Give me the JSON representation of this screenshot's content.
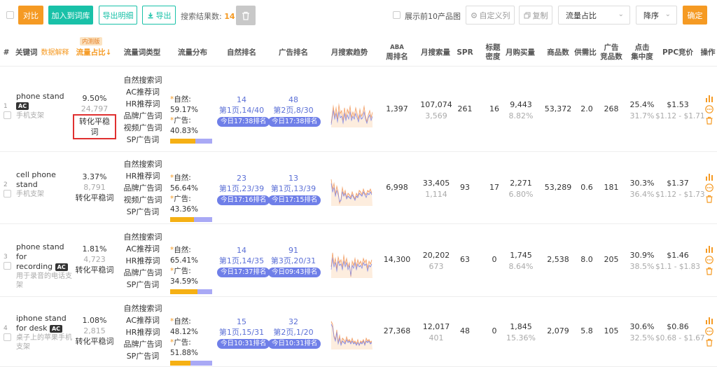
{
  "toolbar": {
    "compare_label": "对比",
    "add_library_label": "加入到词库",
    "export_detail_label": "导出明细",
    "export_label": "导出",
    "result_label": "搜索结果数:",
    "result_count": "14",
    "show_top10_label": "展示前10产品图",
    "custom_columns_label": "自定义列",
    "copy_label": "复制",
    "sort_field_value": "流量占比",
    "sort_order_value": "降序",
    "confirm_label": "确定"
  },
  "columns": {
    "index": "#",
    "keyword": "关键词",
    "keyword_sub": "数据解释",
    "beta": "内测版",
    "traffic_share": "流量占比",
    "traffic_type": "流量词类型",
    "traffic_dist": "流量分布",
    "organic_rank": "自然排名",
    "ad_rank": "广告排名",
    "trend": "月搜索趋势",
    "aba_rank_1": "ABA",
    "aba_rank_2": "周排名",
    "monthly_search": "月搜索量",
    "spr": "SPR",
    "title_density_1": "标题",
    "title_density_2": "密度",
    "monthly_purchase": "月购买量",
    "products": "商品数",
    "supply_ratio": "供需比",
    "ad_products_1": "广告",
    "ad_products_2": "竞品数",
    "click_conc_1": "点击",
    "click_conc_2": "集中度",
    "ppc": "PPC竞价",
    "actions": "操作"
  },
  "rows": [
    {
      "num": "1",
      "keyword_line1": "phone stand",
      "keyword_line2": "",
      "ac": "AC",
      "cn": "手机支架",
      "share": "9.50%",
      "share_sub": "24,797",
      "tag": "转化平稳词",
      "types": [
        "自然搜索词",
        "AC推荐词",
        "HR推荐词",
        "品牌广告词",
        "视频广告词",
        "SP广告词"
      ],
      "organic_label": "自然:",
      "organic_pct": "59.17%",
      "organic_frac": 0.5917,
      "ad_label": "广告:",
      "ad_pct": "40.83%",
      "org_rank": "14",
      "org_page": "第1页,14/40",
      "org_time": "今日17:38排名",
      "ad_rank": "48",
      "ad_page": "第2页,8/30",
      "ad_time": "今日17:38排名",
      "aba": "1,397",
      "search": "107,074",
      "search_sub": "3,569",
      "spr": "261",
      "density": "16",
      "purchase": "9,443",
      "purchase_pct": "8.82%",
      "products": "53,372",
      "supply": "2.0",
      "ad_products": "268",
      "click": "25.4%",
      "click_sub": "31.7%",
      "ppc": "$1.53",
      "ppc_range": "$1.12 - $1.71"
    },
    {
      "num": "2",
      "keyword_line1": "cell phone",
      "keyword_line2": "stand",
      "ac": "",
      "cn": "手机支架",
      "share": "3.37%",
      "share_sub": "8,791",
      "tag": "转化平稳词",
      "types": [
        "自然搜索词",
        "HR推荐词",
        "品牌广告词",
        "视频广告词",
        "SP广告词"
      ],
      "organic_label": "自然:",
      "organic_pct": "56.64%",
      "organic_frac": 0.5664,
      "ad_label": "广告:",
      "ad_pct": "43.36%",
      "org_rank": "23",
      "org_page": "第1页,23/39",
      "org_time": "今日17:16排名",
      "ad_rank": "13",
      "ad_page": "第1页,13/39",
      "ad_time": "今日17:15排名",
      "aba": "6,998",
      "search": "33,405",
      "search_sub": "1,114",
      "spr": "93",
      "density": "17",
      "purchase": "2,271",
      "purchase_pct": "6.80%",
      "products": "53,289",
      "supply": "0.6",
      "ad_products": "181",
      "click": "30.3%",
      "click_sub": "36.4%",
      "ppc": "$1.37",
      "ppc_range": "$1.12 - $1.73"
    },
    {
      "num": "3",
      "keyword_line1": "phone stand for",
      "keyword_line2": "recording",
      "ac": "AC",
      "cn": "用于录音的电话支架",
      "share": "1.81%",
      "share_sub": "4,723",
      "tag": "转化平稳词",
      "types": [
        "自然搜索词",
        "AC推荐词",
        "HR推荐词",
        "品牌广告词",
        "SP广告词"
      ],
      "organic_label": "自然:",
      "organic_pct": "65.41%",
      "organic_frac": 0.6541,
      "ad_label": "广告:",
      "ad_pct": "34.59%",
      "org_rank": "14",
      "org_page": "第1页,14/35",
      "org_time": "今日17:37排名",
      "ad_rank": "91",
      "ad_page": "第3页,20/31",
      "ad_time": "今日09:43排名",
      "aba": "14,300",
      "search": "20,202",
      "search_sub": "673",
      "spr": "63",
      "density": "0",
      "purchase": "1,745",
      "purchase_pct": "8.64%",
      "products": "2,538",
      "supply": "8.0",
      "ad_products": "205",
      "click": "30.9%",
      "click_sub": "38.5%",
      "ppc": "$1.46",
      "ppc_range": "$1.1 - $1.83"
    },
    {
      "num": "4",
      "keyword_line1": "iphone stand",
      "keyword_line2": "for desk",
      "ac": "AC",
      "cn": "桌子上的苹果手机支架",
      "share": "1.08%",
      "share_sub": "2,815",
      "tag": "转化平稳词",
      "types": [
        "自然搜索词",
        "AC推荐词",
        "HR推荐词",
        "品牌广告词",
        "SP广告词"
      ],
      "organic_label": "自然:",
      "organic_pct": "48.12%",
      "organic_frac": 0.4812,
      "ad_label": "广告:",
      "ad_pct": "51.88%",
      "org_rank": "15",
      "org_page": "第1页,15/31",
      "org_time": "今日10:31排名",
      "ad_rank": "32",
      "ad_page": "第2页,1/20",
      "ad_time": "今日10:31排名",
      "aba": "27,368",
      "search": "12,017",
      "search_sub": "401",
      "spr": "48",
      "density": "0",
      "purchase": "1,845",
      "purchase_pct": "15.36%",
      "products": "2,079",
      "supply": "5.8",
      "ad_products": "105",
      "click": "30.6%",
      "click_sub": "32.5%",
      "ppc": "$0.86",
      "ppc_range": "$0.68 - $1.67"
    }
  ],
  "colors": {
    "orange": "#f59a23",
    "teal": "#19c1a8",
    "blue": "#5b6fd6",
    "pill": "#6f7fe8",
    "bar_organic": "#f5b014",
    "bar_ad": "#a9a9f5",
    "highlight_box": "#e03030"
  },
  "icons": [
    "download-icon",
    "trash-icon",
    "gear-icon",
    "copy-icon",
    "chevron-down-icon",
    "bar-chart-icon",
    "more-icon",
    "delete-icon"
  ]
}
